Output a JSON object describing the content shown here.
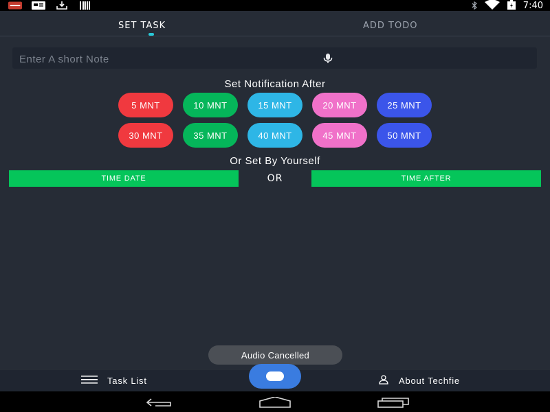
{
  "status_bar": {
    "time": "7:40",
    "left_icons": [
      "gmail-icon",
      "message-icon",
      "download-icon",
      "barcode-icon"
    ],
    "right_icons": [
      "bluetooth-icon",
      "wifi-icon",
      "battery-charging-icon"
    ]
  },
  "tabs": [
    {
      "label": "SET TASK",
      "active": true
    },
    {
      "label": "ADD TODO",
      "active": false
    }
  ],
  "note": {
    "placeholder": "Enter A short Note",
    "value": "",
    "mic_icon": "microphone-icon"
  },
  "notification_heading": "Set Notification After",
  "intervals": [
    {
      "label": "5 MNT",
      "color": "#f0393f"
    },
    {
      "label": "10 MNT",
      "color": "#05b65a"
    },
    {
      "label": "15 MNT",
      "color": "#2eb6e6"
    },
    {
      "label": "20 MNT",
      "color": "#f071c9"
    },
    {
      "label": "25 MNT",
      "color": "#3b55ea"
    },
    {
      "label": "30 MNT",
      "color": "#f0393f"
    },
    {
      "label": "35 MNT",
      "color": "#05b65a"
    },
    {
      "label": "40 MNT",
      "color": "#2eb6e6"
    },
    {
      "label": "45 MNT",
      "color": "#f071c9"
    },
    {
      "label": "50 MNT",
      "color": "#3b55ea"
    }
  ],
  "custom_heading": "Or Set By Yourself",
  "time_date_label": "TIME DATE",
  "or_label": "OR",
  "time_after_label": "TIME AFTER",
  "toast": "Audio Cancelled",
  "bottom_bar": {
    "task_list_label": "Task List",
    "about_label": "About Techfie"
  },
  "colors": {
    "background": "#262c36",
    "accent_green": "#05c55a",
    "fab": "#3a7ce0",
    "tab_indicator": "#29c7d6"
  }
}
